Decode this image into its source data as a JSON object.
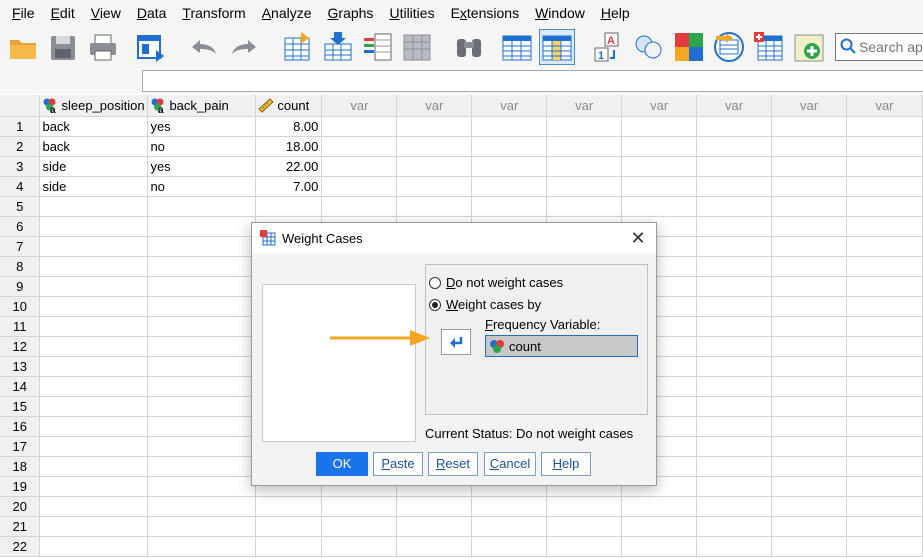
{
  "menu": [
    {
      "pre": "",
      "ul": "F",
      "post": "ile"
    },
    {
      "pre": "",
      "ul": "E",
      "post": "dit"
    },
    {
      "pre": "",
      "ul": "V",
      "post": "iew"
    },
    {
      "pre": "",
      "ul": "D",
      "post": "ata"
    },
    {
      "pre": "",
      "ul": "T",
      "post": "ransform"
    },
    {
      "pre": "",
      "ul": "A",
      "post": "nalyze"
    },
    {
      "pre": "",
      "ul": "G",
      "post": "raphs"
    },
    {
      "pre": "",
      "ul": "U",
      "post": "tilities"
    },
    {
      "pre": "E",
      "ul": "x",
      "post": "tensions"
    },
    {
      "pre": "",
      "ul": "W",
      "post": "indow"
    },
    {
      "pre": "",
      "ul": "H",
      "post": "elp"
    }
  ],
  "search": {
    "placeholder": "Search app"
  },
  "grid": {
    "columns": [
      "sleep_position",
      "back_pain",
      "count"
    ],
    "var_label": "var",
    "rows": [
      [
        "back",
        "yes",
        "8.00"
      ],
      [
        "back",
        "no",
        "18.00"
      ],
      [
        "side",
        "yes",
        "22.00"
      ],
      [
        "side",
        "no",
        "7.00"
      ]
    ],
    "row_count": 22
  },
  "dialog": {
    "title": "Weight Cases",
    "option_none": {
      "ul": "D",
      "rest": "o not weight cases"
    },
    "option_by": {
      "ul": "W",
      "rest": "eight cases by"
    },
    "freq_label": {
      "ul": "F",
      "rest": "requency Variable:"
    },
    "freq_value": "count",
    "status": "Current Status: Do not weight cases",
    "buttons": {
      "ok": "OK",
      "paste": {
        "ul": "P",
        "rest": "aste"
      },
      "reset": {
        "ul": "R",
        "rest": "eset"
      },
      "cancel": {
        "ul": "C",
        "rest": "ancel"
      },
      "help": {
        "ul": "H",
        "rest": "elp"
      }
    }
  },
  "colors": {
    "primary_button": "#1a73e8",
    "arrow": "#f5a623",
    "focus": "#1f6fd1"
  }
}
